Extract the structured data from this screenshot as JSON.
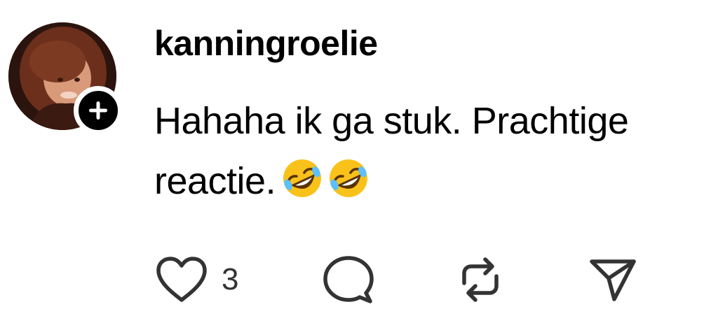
{
  "post": {
    "username": "kanningroelie",
    "text": "Hahaha ik ga stuk. Prachtige reactie.",
    "emojis": [
      "rolling-on-floor-laughing",
      "rolling-on-floor-laughing"
    ]
  },
  "actions": {
    "like_count": "3",
    "icons": [
      "heart-icon",
      "comment-icon",
      "repost-icon",
      "share-icon"
    ]
  },
  "colors": {
    "text": "#000000",
    "icon": "#333333",
    "follow_badge": "#000000",
    "emoji_face": "#F9C21B"
  }
}
